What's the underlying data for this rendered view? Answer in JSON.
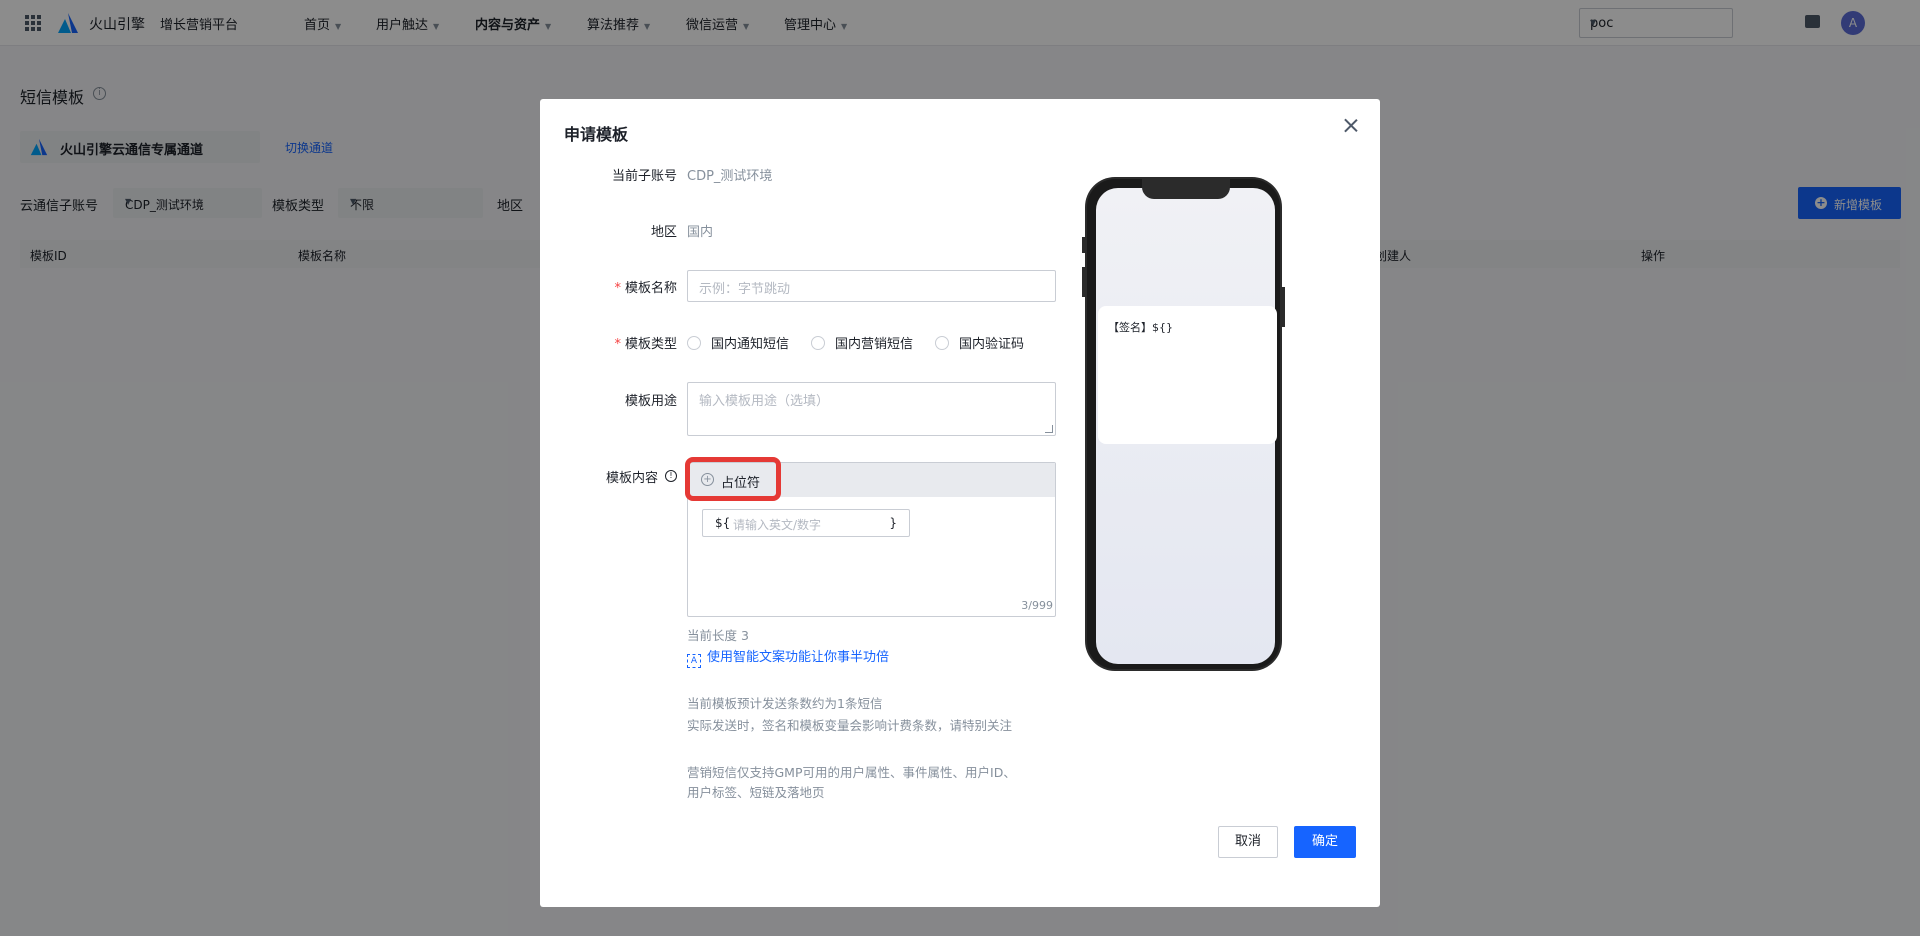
{
  "topnav": {
    "brand": "火山引擎",
    "platform": "增长营销平台",
    "items": [
      {
        "label": "首页"
      },
      {
        "label": "用户触达"
      },
      {
        "label": "内容与资产"
      },
      {
        "label": "算法推荐"
      },
      {
        "label": "微信运营"
      },
      {
        "label": "管理中心"
      }
    ],
    "project": "poc",
    "avatar": "A"
  },
  "page": {
    "title": "短信模板",
    "channel_name": "火山引擎云通信专属通道",
    "switch_channel": "切换通道",
    "filters": {
      "sub_account_label": "云通信子账号",
      "sub_account_value": "CDP_测试环境",
      "type_label": "模板类型",
      "type_value": "不限",
      "region_label": "地区"
    },
    "add_button": "新增模板",
    "table_headers": [
      "模板ID",
      "模板名称",
      "创建人",
      "操作"
    ]
  },
  "modal": {
    "title": "申请模板",
    "sub_account_label": "当前子账号",
    "sub_account_value": "CDP_测试环境",
    "region_label": "地区",
    "region_value": "国内",
    "name_label": "模板名称",
    "name_placeholder": "示例：字节跳动",
    "type_label": "模板类型",
    "type_options": [
      "国内通知短信",
      "国内营销短信",
      "国内验证码"
    ],
    "usage_label": "模板用途",
    "usage_placeholder": "输入模板用途（选填）",
    "content_label": "模板内容",
    "placeholder_button": "占位符",
    "var_prefix": "${",
    "var_placeholder": "请输入英文/数字",
    "var_suffix": "}",
    "counter": "3/999",
    "current_length": "当前长度 3",
    "ai_link": "使用智能文案功能让你事半功倍",
    "estimate_note": "当前模板预计发送条数约为1条短信",
    "billing_note": "实际发送时，签名和模板变量会影响计费条数，请特别关注",
    "marketing_note_1": "营销短信仅支持GMP可用的用户属性、事件属性、用户ID、",
    "marketing_note_2": "用户标签、短链及落地页",
    "preview_text": "【签名】${}",
    "cancel": "取消",
    "ok": "确定"
  }
}
